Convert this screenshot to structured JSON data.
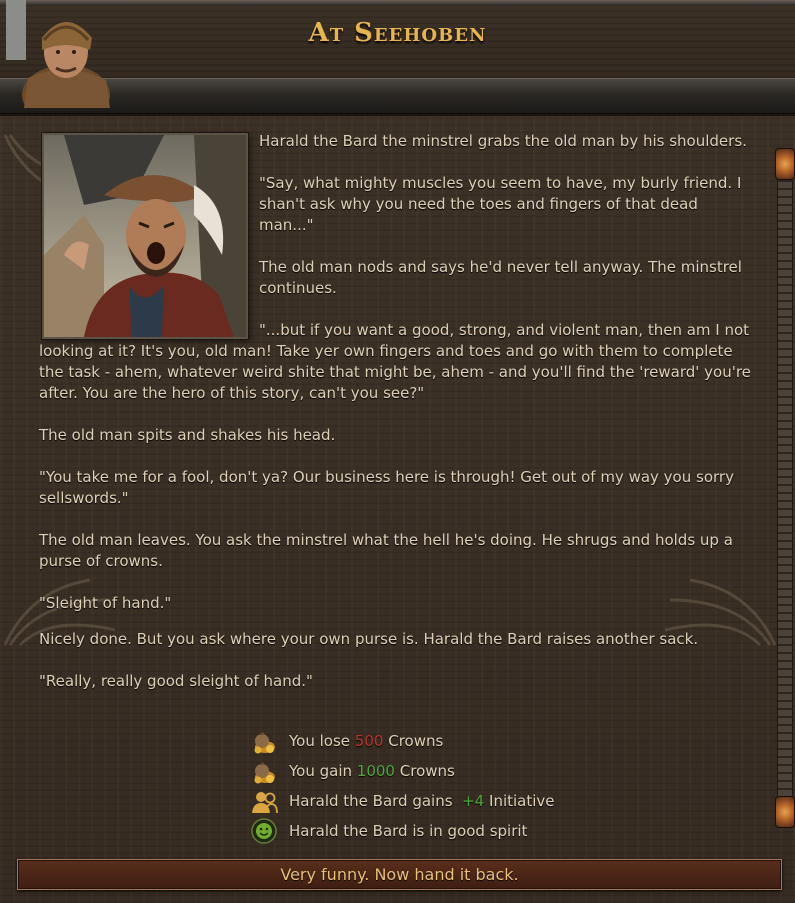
{
  "event": {
    "title": "At Seehoben",
    "story": [
      "Harald the Bard the minstrel grabs the old man by his shoulders.",
      "\"Say, what mighty muscles you seem to have, my burly friend. I shan't ask why you need the toes and fingers of that dead man...\"",
      "The old man nods and says he'd never tell anyway. The minstrel continues.",
      "\"...but if you want a good, strong, and violent man, then am I not looking at it? It's you, old man! Take yer own fingers and toes and go with them to complete the task - ahem, whatever weird shite that might be, ahem - and you'll find the 'reward' you're after. You are the hero of this story, can't you see?\"",
      "The old man spits and shakes his head.",
      "\"You take me for a fool, don't ya? Our business here is through! Get out of my way you sorry sellswords.\"",
      "The old man leaves. You ask the minstrel what the hell he's doing. He shrugs and holds up a purse of crowns.",
      "\"Sleight of hand.\"",
      "Nicely done. But you ask where your own purse is. Harald the Bard raises another sack.",
      "\"Really, really good sleight of hand.\""
    ]
  },
  "results": {
    "lose": {
      "prefix": "You lose",
      "amount": "500",
      "suffix": "Crowns",
      "icon": "money-bag-icon"
    },
    "gain": {
      "prefix": "You gain",
      "amount": "1000",
      "suffix": "Crowns",
      "icon": "money-bag-icon"
    },
    "initiative": {
      "prefix": "Harald the Bard gains",
      "amount": "+4",
      "suffix": "Initiative",
      "icon": "initiative-icon"
    },
    "mood": {
      "text": "Harald the Bard is in good spirit",
      "icon": "good-mood-icon"
    }
  },
  "choice": {
    "label": "Very funny. Now hand it back."
  },
  "colors": {
    "title": "#e7b450",
    "negative": "#b8362e",
    "positive": "#4ea83a",
    "text": "#ddd0b8"
  }
}
